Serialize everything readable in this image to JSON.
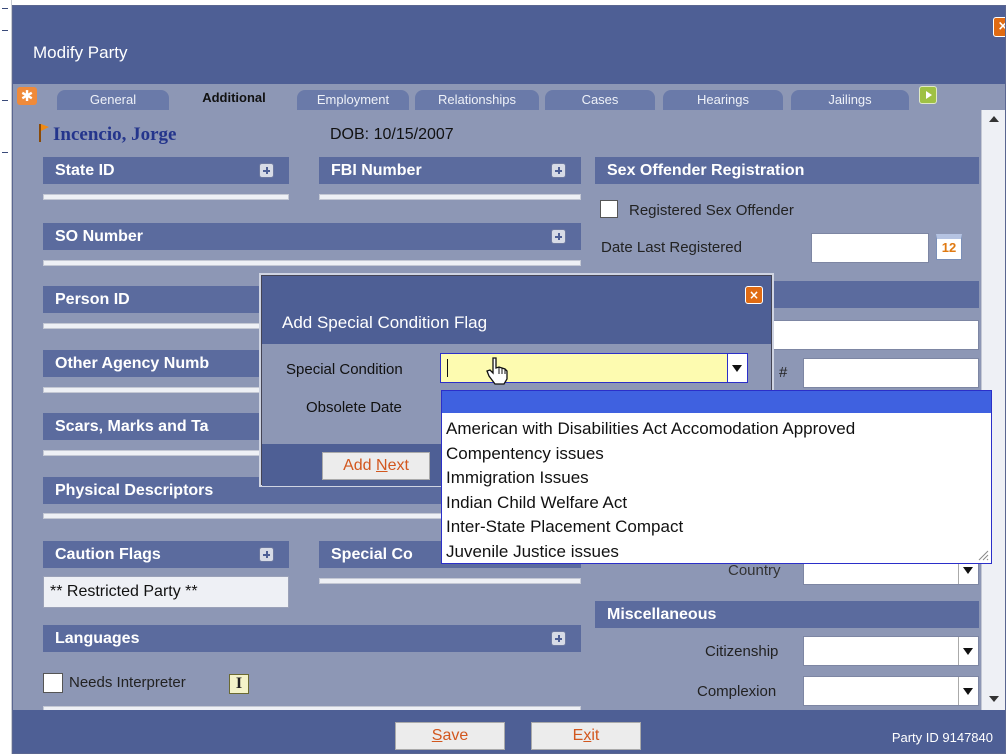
{
  "window": {
    "title": "Modify Party",
    "close_label": "×"
  },
  "tabs": [
    {
      "label": "General"
    },
    {
      "label": "Additional"
    },
    {
      "label": "Employment"
    },
    {
      "label": "Relationships"
    },
    {
      "label": "Cases"
    },
    {
      "label": "Hearings"
    },
    {
      "label": "Jailings"
    }
  ],
  "active_tab": "Additional",
  "party": {
    "name": "Incencio, Jorge",
    "dob_label": "DOB:",
    "dob_value": "10/15/2007"
  },
  "sections": {
    "state_id": "State ID",
    "fbi_number": "FBI Number",
    "sex_offender": "Sex Offender Registration",
    "so_number": "SO Number",
    "person_id": "Person ID",
    "other_agency": "Other Agency Numb",
    "scars": "Scars, Marks and Ta",
    "physical": "Physical Descriptors",
    "caution_flags": "Caution Flags",
    "special_conditions": "Special Co",
    "languages": "Languages",
    "miscellaneous": "Miscellaneous"
  },
  "sex_offender": {
    "registered_label": "Registered Sex Offender",
    "date_label": "Date Last Registered",
    "calendar_text": "12"
  },
  "partial_labels": {
    "hash": "#",
    "country": "Country"
  },
  "caution_flags": {
    "restricted": "** Restricted Party **"
  },
  "languages": {
    "needs_interpreter": "Needs Interpreter",
    "interp_icon_text": "I"
  },
  "miscellaneous": {
    "citizenship_label": "Citizenship",
    "complexion_label": "Complexion"
  },
  "footer": {
    "save_label": "ave",
    "save_accel": "S",
    "exit_label_pre": "E",
    "exit_accel": "x",
    "exit_label_post": "it",
    "party_id": "Party ID 9147840"
  },
  "modal": {
    "title": "Add Special Condition Flag",
    "close_label": "×",
    "special_condition_label": "Special Condition",
    "obsolete_date_label": "Obsolete Date",
    "add_next_pre": "Add ",
    "add_next_accel": "N",
    "add_next_post": "ext"
  },
  "dropdown": {
    "options": [
      "American with Disabilities Act Accomodation Approved",
      "Compentency issues",
      "Immigration Issues",
      "Indian Child Welfare Act",
      "Inter-State Placement Compact",
      "Juvenile Justice issues"
    ]
  },
  "colors": {
    "titlebar": "#4e5f95",
    "panel": "#8d97b5",
    "section_header": "#5b6b9e",
    "accent_orange": "#e06b13",
    "highlight_blue": "#3f61e0",
    "input_yellow": "#fdfbb0"
  },
  "icons": {
    "flag": "flag-icon",
    "plus": "plus-icon",
    "calendar": "calendar-icon",
    "close": "close-icon",
    "interpreter": "interpreter-icon",
    "hand_cursor": "hand-cursor-icon"
  }
}
